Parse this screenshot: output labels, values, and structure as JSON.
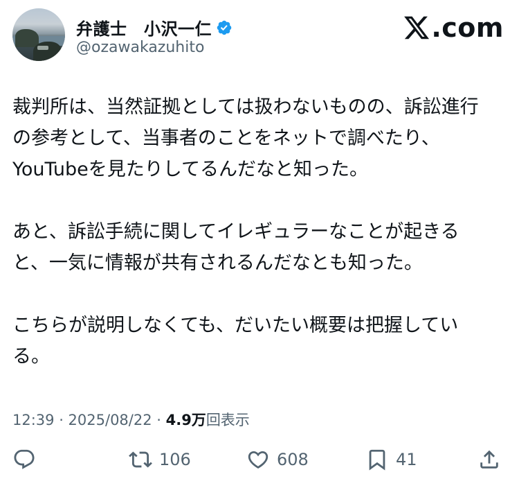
{
  "author": {
    "display_name": "弁護士　小沢一仁",
    "handle": "@ozawakazuhito",
    "verified_icon": "verified-badge-icon",
    "avatar_icon": "avatar"
  },
  "brand": {
    "logo_icon": "x-logo-icon",
    "text": ".com"
  },
  "tweet": {
    "paragraphs": [
      "裁判所は、当然証拠としては扱わないものの、訴訟進行\nの参考として、当事者のことをネットで調べたり、\nYouTubeを見たりしてるんだなと知った。",
      "あと、訴訟手続に関してイレギュラーなことが起きる\nと、一気に情報が共有されるんだなとも知った。",
      "こちらが説明しなくても、だいたい概要は把握してい\nる。"
    ],
    "timestamp": "12:39 · 2025/08/22 · ",
    "views_count": "4.9万",
    "views_label": "回表示"
  },
  "actions": {
    "reply_icon": "reply-icon",
    "retweet_icon": "retweet-icon",
    "retweet_count": "106",
    "like_icon": "heart-icon",
    "like_count": "608",
    "bookmark_icon": "bookmark-icon",
    "bookmark_count": "41",
    "share_icon": "share-icon"
  },
  "colors": {
    "verified": "#1d9bf0",
    "secondary_text": "#536471",
    "primary_text": "#0f1419"
  }
}
